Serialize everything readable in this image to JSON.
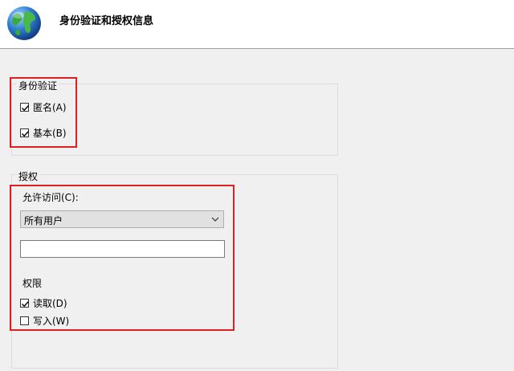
{
  "header": {
    "title": "身份验证和授权信息",
    "icon": "globe-icon"
  },
  "authentication": {
    "label": "身份验证",
    "anonymous": {
      "label": "匿名(A)",
      "checked": true
    },
    "basic": {
      "label": "基本(B)",
      "checked": true
    }
  },
  "authorization": {
    "label": "授权",
    "allow_access_label": "允许访问(C):",
    "allow_access_value": "所有用户",
    "users_input_value": "",
    "permissions_label": "权限",
    "read": {
      "label": "读取(D)",
      "checked": true
    },
    "write": {
      "label": "写入(W)",
      "checked": false
    }
  },
  "colors": {
    "highlight": "#e02020",
    "background": "#f0f0f0",
    "header_bg": "#ffffff"
  }
}
